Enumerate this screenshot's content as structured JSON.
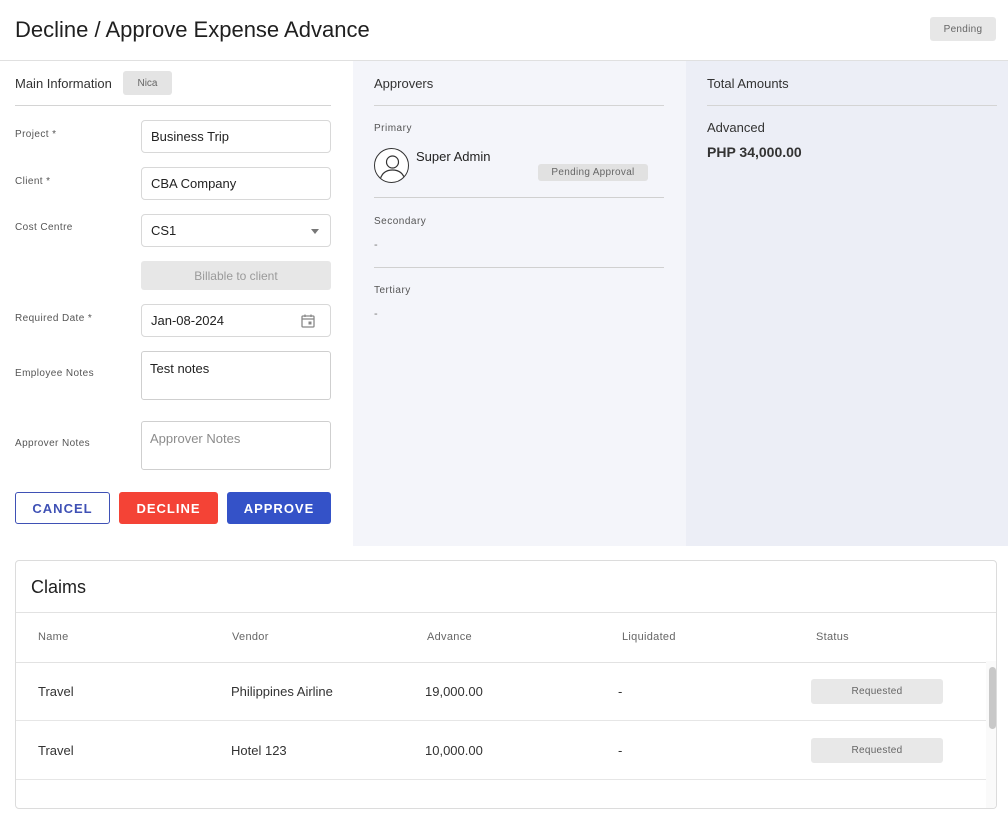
{
  "header": {
    "title": "Decline / Approve Expense Advance",
    "status": "Pending"
  },
  "main_info": {
    "title": "Main Information",
    "employee_tag": "Nica",
    "fields": {
      "project": {
        "label": "Project *",
        "value": "Business Trip"
      },
      "client": {
        "label": "Client *",
        "value": "CBA Company"
      },
      "cost_centre": {
        "label": "Cost Centre",
        "value": "CS1"
      },
      "billable": {
        "label": "Billable to client"
      },
      "required_date": {
        "label": "Required Date *",
        "value": "Jan-08-2024"
      },
      "employee_notes": {
        "label": "Employee Notes",
        "value": "Test notes"
      },
      "approver_notes": {
        "label": "Approver Notes",
        "placeholder": "Approver Notes"
      }
    },
    "buttons": {
      "cancel": "CANCEL",
      "decline": "DECLINE",
      "approve": "APPROVE"
    }
  },
  "approvers": {
    "title": "Approvers",
    "primary": {
      "label": "Primary",
      "name": "Super Admin",
      "status": "Pending Approval",
      "icon": "user-icon"
    },
    "secondary": {
      "label": "Secondary",
      "value": "-"
    },
    "tertiary": {
      "label": "Tertiary",
      "value": "-"
    }
  },
  "totals": {
    "title": "Total Amounts",
    "advanced_label": "Advanced",
    "advanced_value": "PHP 34,000.00"
  },
  "claims": {
    "title": "Claims",
    "columns": [
      "Name",
      "Vendor",
      "Advance",
      "Liquidated",
      "Status"
    ],
    "rows": [
      {
        "name": "Travel",
        "vendor": "Philippines Airline",
        "advance": "19,000.00",
        "liquidated": "-",
        "status": "Requested"
      },
      {
        "name": "Travel",
        "vendor": "Hotel 123",
        "advance": "10,000.00",
        "liquidated": "-",
        "status": "Requested"
      }
    ]
  },
  "colors": {
    "primary": "#3452c8",
    "danger": "#f44336",
    "approver_bg": "#f4f5fa",
    "totals_bg": "#eceef6"
  }
}
